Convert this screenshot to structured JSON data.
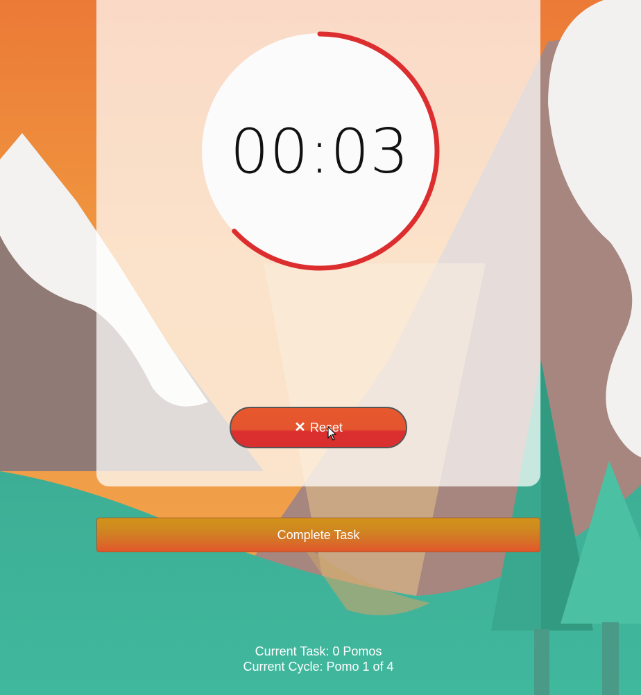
{
  "timer": {
    "display": "00:03",
    "progress_remaining": 0.63,
    "ring_color": "#dc2d2f"
  },
  "controls": {
    "reset_label": "Reset",
    "reset_icon": "close-icon",
    "complete_label": "Complete Task"
  },
  "status": {
    "current_task": "Current Task: 0 Pomos",
    "current_cycle": "Current Cycle: Pomo 1 of 4"
  },
  "colors": {
    "accent_red": "#dc2d2f",
    "sky_orange": "#e8843f",
    "grass_teal": "#3fb59b"
  }
}
